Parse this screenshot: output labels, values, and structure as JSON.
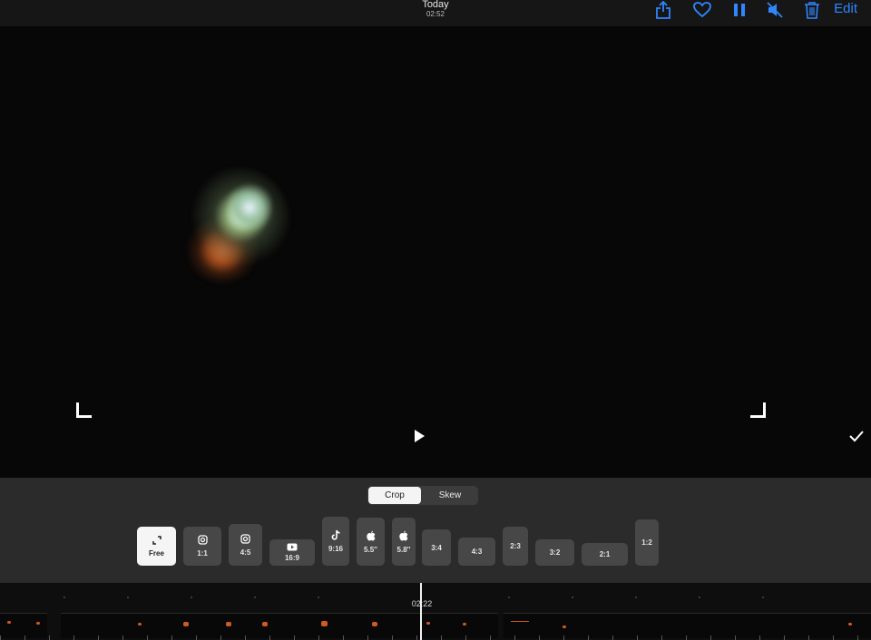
{
  "header": {
    "title": "Today",
    "subtitle": "02:52",
    "edit_label": "Edit",
    "icons": [
      "share-icon",
      "heart-icon",
      "pause-icon",
      "mute-icon",
      "trash-icon"
    ],
    "accent_color": "#2f86ff"
  },
  "mode_tabs": [
    {
      "label": "Crop",
      "selected": true
    },
    {
      "label": "Skew",
      "selected": false
    }
  ],
  "aspect_ratios": [
    {
      "label": "Free",
      "icon": "expand-icon",
      "selected": true
    },
    {
      "label": "1:1",
      "icon": "instagram-icon"
    },
    {
      "label": "4:5",
      "icon": "instagram-icon"
    },
    {
      "label": "16:9",
      "icon": "youtube-icon"
    },
    {
      "label": "9:16",
      "icon": "tiktok-icon"
    },
    {
      "label": "5.5''",
      "icon": "apple-icon"
    },
    {
      "label": "5.8''",
      "icon": "apple-icon"
    },
    {
      "label": "3:4"
    },
    {
      "label": "4:3"
    },
    {
      "label": "2:3"
    },
    {
      "label": "3:2"
    },
    {
      "label": "2:1"
    },
    {
      "label": "1:2"
    }
  ],
  "timeline": {
    "current_time": "02:22"
  }
}
